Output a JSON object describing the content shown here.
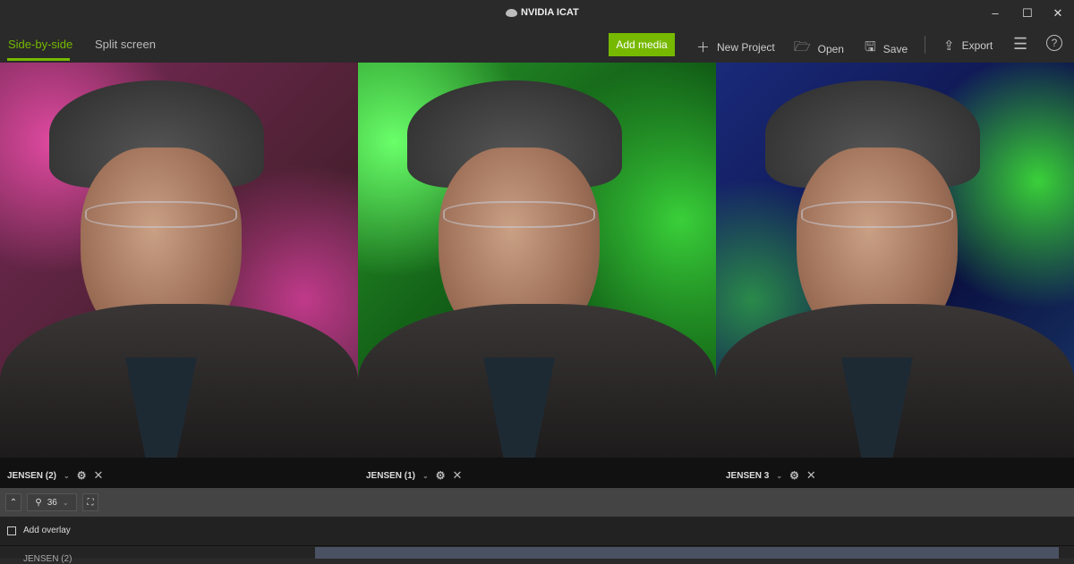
{
  "window": {
    "title": "NVIDIA ICAT",
    "minimize": "–",
    "maximize": "☐",
    "close": "✕"
  },
  "toolbar": {
    "tabs": [
      {
        "label": "Side-by-side",
        "active": true
      },
      {
        "label": "Split screen",
        "active": false
      }
    ],
    "add_media": "Add media",
    "new_project": "New Project",
    "open": "Open",
    "save": "Save",
    "export": "Export",
    "accent": "#76b900"
  },
  "panels": [
    {
      "name": "JENSEN (2)",
      "bg": "#8a2a6a"
    },
    {
      "name": "JENSEN (1)",
      "bg": "#2aa02a"
    },
    {
      "name": "JENSEN 3",
      "bg": "#1a2a6a"
    }
  ],
  "zoom": {
    "value": "36"
  },
  "overlay": {
    "label": "Add overlay"
  },
  "track": {
    "name": "JENSEN (2)"
  }
}
